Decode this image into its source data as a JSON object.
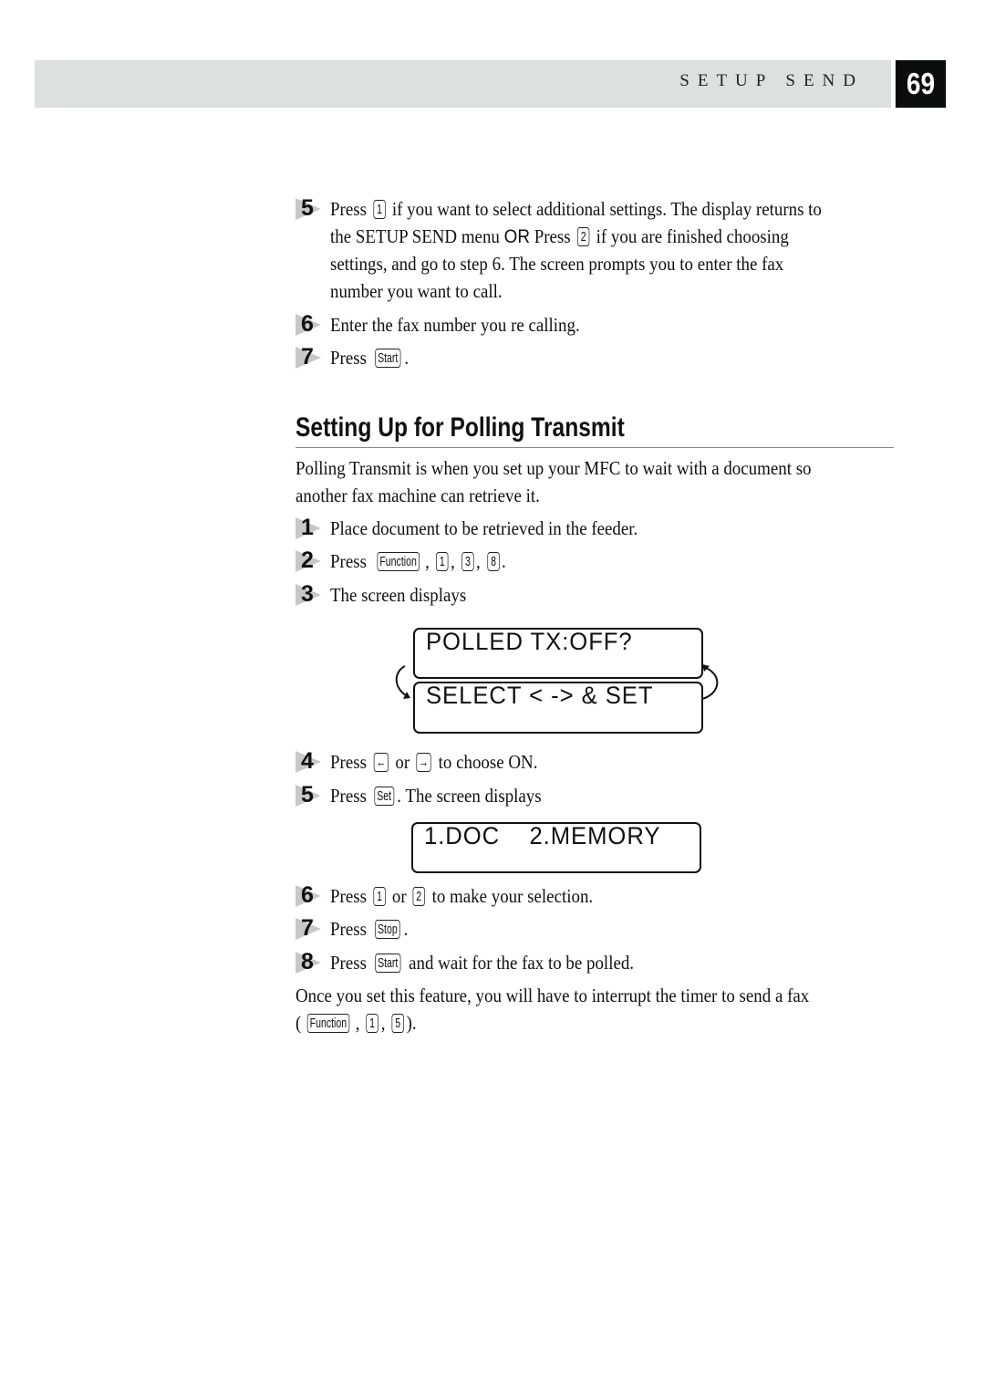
{
  "header": {
    "section_title": "SETUP SEND",
    "page_number": "69"
  },
  "top_steps": [
    {
      "number": "5",
      "parts": [
        "Press ",
        {
          "key": "1"
        },
        " if you want to select additional settings. The display returns to"
      ]
    },
    {
      "continuation": [
        "the SETUP SEND menu ",
        {
          "sans": "OR"
        },
        " Press ",
        {
          "key": "2"
        },
        " if you are finished choosing"
      ]
    },
    {
      "continuation": [
        "settings, and go to step 6. The screen prompts you to enter the fax"
      ]
    },
    {
      "continuation": [
        "number you want to call."
      ]
    },
    {
      "number": "6",
      "parts": [
        "Enter the fax number you re calling."
      ]
    },
    {
      "number": "7",
      "parts": [
        "Press ",
        {
          "key": "Start"
        },
        "."
      ]
    }
  ],
  "section": {
    "title": "Setting Up for Polling Transmit",
    "intro_line1": "Polling Transmit is when you set up your MFC to wait with a document so",
    "intro_line2": "another fax machine can retrieve it."
  },
  "steps": [
    {
      "number": "1",
      "parts": [
        "Place document to be retrieved in the feeder."
      ]
    },
    {
      "number": "2",
      "parts": [
        "Press ",
        {
          "key": "Function"
        },
        ", ",
        {
          "key": "1"
        },
        ", ",
        {
          "key": "3"
        },
        ", ",
        {
          "key": "8"
        },
        "."
      ]
    },
    {
      "number": "3",
      "parts": [
        "The screen displays"
      ]
    },
    {
      "number": "4",
      "parts": [
        "Press ",
        {
          "key": "←"
        },
        " or ",
        {
          "key": "→"
        },
        " to choose ON."
      ]
    },
    {
      "number": "5",
      "parts": [
        "Press ",
        {
          "key": "Set"
        },
        ". The screen displays"
      ]
    },
    {
      "number": "6",
      "parts": [
        "Press ",
        {
          "key": "1"
        },
        " or ",
        {
          "key": "2"
        },
        " to make your selection."
      ]
    },
    {
      "number": "7",
      "parts": [
        "Press ",
        {
          "key": "Stop"
        },
        "."
      ]
    },
    {
      "number": "8",
      "parts": [
        "Press ",
        {
          "key": "Start"
        },
        " and wait for the fax to be polled."
      ]
    }
  ],
  "lcd_displays": {
    "polled_line1": "POLLED TX:OFF?",
    "polled_line2": "SELECT < -> & SET",
    "mode_line": "1.DOC    2.MEMORY"
  },
  "footer_note": {
    "line1": "Once you set this feature, you will have to interrupt the timer to send a fax",
    "line2_parts": [
      "(",
      {
        "key": "Function"
      },
      ", ",
      {
        "key": "1"
      },
      ", ",
      {
        "key": "5"
      },
      ")."
    ]
  }
}
